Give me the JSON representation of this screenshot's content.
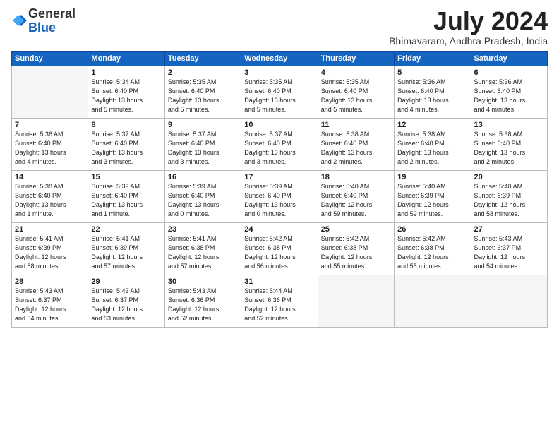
{
  "header": {
    "logo_general": "General",
    "logo_blue": "Blue",
    "month": "July 2024",
    "location": "Bhimavaram, Andhra Pradesh, India"
  },
  "weekdays": [
    "Sunday",
    "Monday",
    "Tuesday",
    "Wednesday",
    "Thursday",
    "Friday",
    "Saturday"
  ],
  "weeks": [
    [
      {
        "day": null,
        "info": null
      },
      {
        "day": "1",
        "info": "Sunrise: 5:34 AM\nSunset: 6:40 PM\nDaylight: 13 hours\nand 5 minutes."
      },
      {
        "day": "2",
        "info": "Sunrise: 5:35 AM\nSunset: 6:40 PM\nDaylight: 13 hours\nand 5 minutes."
      },
      {
        "day": "3",
        "info": "Sunrise: 5:35 AM\nSunset: 6:40 PM\nDaylight: 13 hours\nand 5 minutes."
      },
      {
        "day": "4",
        "info": "Sunrise: 5:35 AM\nSunset: 6:40 PM\nDaylight: 13 hours\nand 5 minutes."
      },
      {
        "day": "5",
        "info": "Sunrise: 5:36 AM\nSunset: 6:40 PM\nDaylight: 13 hours\nand 4 minutes."
      },
      {
        "day": "6",
        "info": "Sunrise: 5:36 AM\nSunset: 6:40 PM\nDaylight: 13 hours\nand 4 minutes."
      }
    ],
    [
      {
        "day": "7",
        "info": "Sunrise: 5:36 AM\nSunset: 6:40 PM\nDaylight: 13 hours\nand 4 minutes."
      },
      {
        "day": "8",
        "info": "Sunrise: 5:37 AM\nSunset: 6:40 PM\nDaylight: 13 hours\nand 3 minutes."
      },
      {
        "day": "9",
        "info": "Sunrise: 5:37 AM\nSunset: 6:40 PM\nDaylight: 13 hours\nand 3 minutes."
      },
      {
        "day": "10",
        "info": "Sunrise: 5:37 AM\nSunset: 6:40 PM\nDaylight: 13 hours\nand 3 minutes."
      },
      {
        "day": "11",
        "info": "Sunrise: 5:38 AM\nSunset: 6:40 PM\nDaylight: 13 hours\nand 2 minutes."
      },
      {
        "day": "12",
        "info": "Sunrise: 5:38 AM\nSunset: 6:40 PM\nDaylight: 13 hours\nand 2 minutes."
      },
      {
        "day": "13",
        "info": "Sunrise: 5:38 AM\nSunset: 6:40 PM\nDaylight: 13 hours\nand 2 minutes."
      }
    ],
    [
      {
        "day": "14",
        "info": "Sunrise: 5:38 AM\nSunset: 6:40 PM\nDaylight: 13 hours\nand 1 minute."
      },
      {
        "day": "15",
        "info": "Sunrise: 5:39 AM\nSunset: 6:40 PM\nDaylight: 13 hours\nand 1 minute."
      },
      {
        "day": "16",
        "info": "Sunrise: 5:39 AM\nSunset: 6:40 PM\nDaylight: 13 hours\nand 0 minutes."
      },
      {
        "day": "17",
        "info": "Sunrise: 5:39 AM\nSunset: 6:40 PM\nDaylight: 13 hours\nand 0 minutes."
      },
      {
        "day": "18",
        "info": "Sunrise: 5:40 AM\nSunset: 6:40 PM\nDaylight: 12 hours\nand 59 minutes."
      },
      {
        "day": "19",
        "info": "Sunrise: 5:40 AM\nSunset: 6:39 PM\nDaylight: 12 hours\nand 59 minutes."
      },
      {
        "day": "20",
        "info": "Sunrise: 5:40 AM\nSunset: 6:39 PM\nDaylight: 12 hours\nand 58 minutes."
      }
    ],
    [
      {
        "day": "21",
        "info": "Sunrise: 5:41 AM\nSunset: 6:39 PM\nDaylight: 12 hours\nand 58 minutes."
      },
      {
        "day": "22",
        "info": "Sunrise: 5:41 AM\nSunset: 6:39 PM\nDaylight: 12 hours\nand 57 minutes."
      },
      {
        "day": "23",
        "info": "Sunrise: 5:41 AM\nSunset: 6:38 PM\nDaylight: 12 hours\nand 57 minutes."
      },
      {
        "day": "24",
        "info": "Sunrise: 5:42 AM\nSunset: 6:38 PM\nDaylight: 12 hours\nand 56 minutes."
      },
      {
        "day": "25",
        "info": "Sunrise: 5:42 AM\nSunset: 6:38 PM\nDaylight: 12 hours\nand 55 minutes."
      },
      {
        "day": "26",
        "info": "Sunrise: 5:42 AM\nSunset: 6:38 PM\nDaylight: 12 hours\nand 55 minutes."
      },
      {
        "day": "27",
        "info": "Sunrise: 5:43 AM\nSunset: 6:37 PM\nDaylight: 12 hours\nand 54 minutes."
      }
    ],
    [
      {
        "day": "28",
        "info": "Sunrise: 5:43 AM\nSunset: 6:37 PM\nDaylight: 12 hours\nand 54 minutes."
      },
      {
        "day": "29",
        "info": "Sunrise: 5:43 AM\nSunset: 6:37 PM\nDaylight: 12 hours\nand 53 minutes."
      },
      {
        "day": "30",
        "info": "Sunrise: 5:43 AM\nSunset: 6:36 PM\nDaylight: 12 hours\nand 52 minutes."
      },
      {
        "day": "31",
        "info": "Sunrise: 5:44 AM\nSunset: 6:36 PM\nDaylight: 12 hours\nand 52 minutes."
      },
      {
        "day": null,
        "info": null
      },
      {
        "day": null,
        "info": null
      },
      {
        "day": null,
        "info": null
      }
    ]
  ]
}
